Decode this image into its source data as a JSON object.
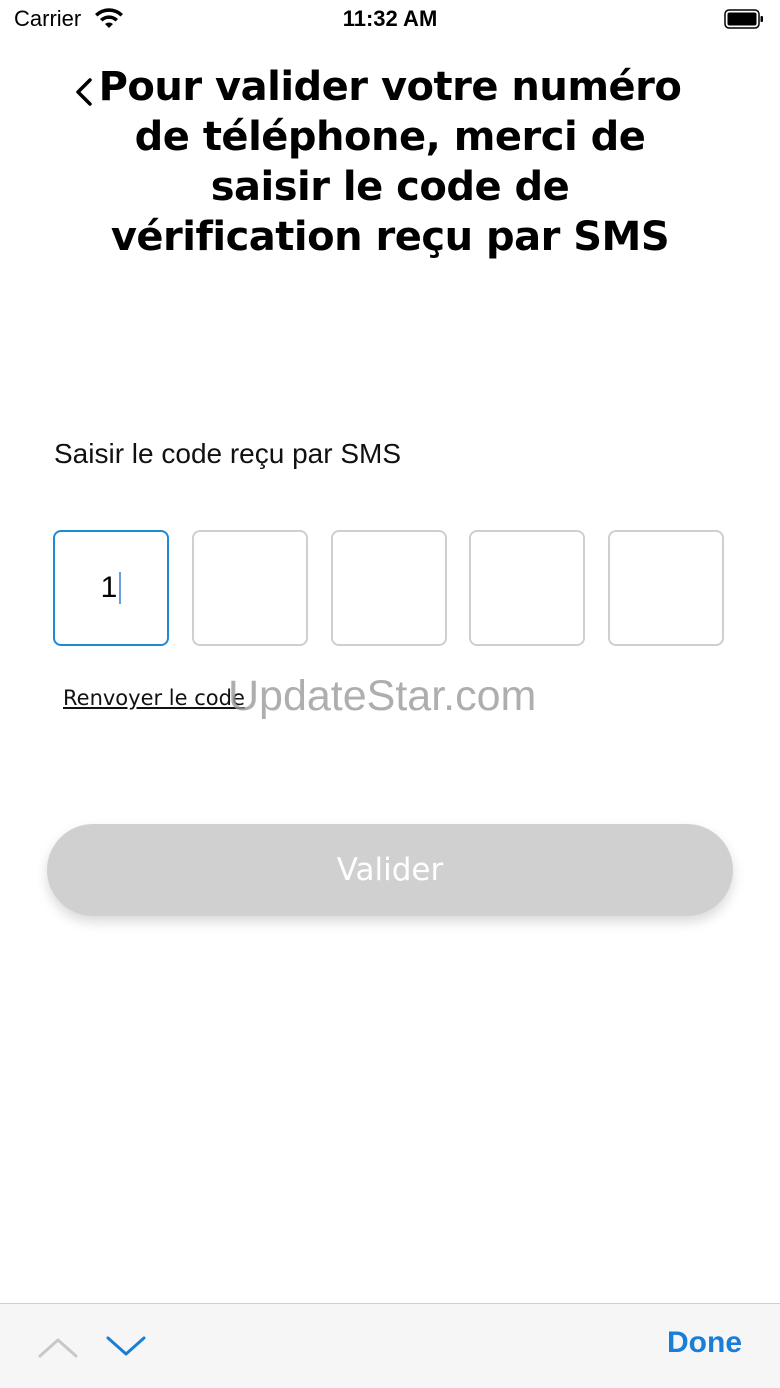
{
  "status_bar": {
    "carrier": "Carrier",
    "time": "11:32 AM"
  },
  "header": {
    "title": "Pour valider votre numéro de téléphone, merci de saisir le code de vérification reçu par SMS"
  },
  "code": {
    "label": "Saisir le code reçu par SMS",
    "digits": [
      "1",
      "",
      "",
      "",
      ""
    ],
    "active_index": 0,
    "active_color": "#1f8ad3"
  },
  "resend_label": "Renvoyer le code",
  "watermark": "UpdateStar.com",
  "submit": {
    "label": "Valider",
    "enabled": false,
    "color": "#d0d0d0"
  },
  "accessory": {
    "done_label": "Done",
    "accent": "#1a7ed6",
    "icons": [
      "chevron-up-icon",
      "chevron-down-icon"
    ]
  }
}
